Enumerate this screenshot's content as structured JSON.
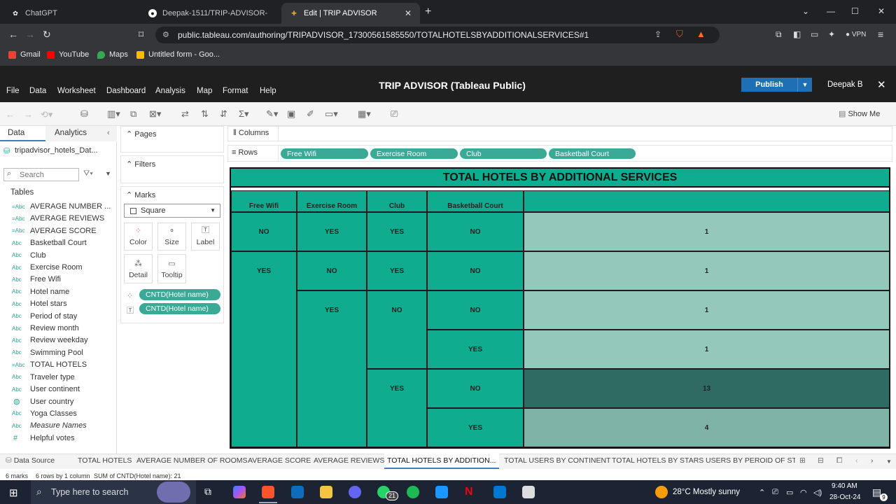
{
  "browser": {
    "tabs": [
      {
        "title": "ChatGPT"
      },
      {
        "title": "Deepak-1511/TRIP-ADVISOR-"
      },
      {
        "title": "Edit | TRIP ADVISOR"
      }
    ],
    "url": "public.tableau.com/authoring/TRIPADVISOR_17300561585550/TOTALHOTELSBYADDITIONALSERVICES#1",
    "vpn_label": "VPN",
    "bookmarks": [
      "Gmail",
      "YouTube",
      "Maps",
      "Untitled form - Goo..."
    ]
  },
  "tableau": {
    "menu": [
      "File",
      "Data",
      "Worksheet",
      "Dashboard",
      "Analysis",
      "Map",
      "Format",
      "Help"
    ],
    "workbook_title": "TRIP ADVISOR (Tableau Public)",
    "publish_label": "Publish",
    "user": "Deepak B",
    "show_me": "Show Me"
  },
  "data_pane": {
    "tab_data": "Data",
    "tab_analytics": "Analytics",
    "datasource": "tripadvisor_hotels_Dat...",
    "search_placeholder": "Search",
    "tables_label": "Tables",
    "fields": [
      {
        "type": "=Abc",
        "name": "AVERAGE NUMBER ..."
      },
      {
        "type": "=Abc",
        "name": "AVERAGE REVIEWS"
      },
      {
        "type": "=Abc",
        "name": "AVERAGE SCORE"
      },
      {
        "type": "Abc",
        "name": "Basketball Court"
      },
      {
        "type": "Abc",
        "name": "Club"
      },
      {
        "type": "Abc",
        "name": "Exercise Room"
      },
      {
        "type": "Abc",
        "name": "Free Wifi"
      },
      {
        "type": "Abc",
        "name": "Hotel name"
      },
      {
        "type": "Abc",
        "name": "Hotel stars"
      },
      {
        "type": "Abc",
        "name": "Period of stay"
      },
      {
        "type": "Abc",
        "name": "Review month"
      },
      {
        "type": "Abc",
        "name": "Review weekday"
      },
      {
        "type": "Abc",
        "name": "Swimming Pool"
      },
      {
        "type": "=Abc",
        "name": "TOTAL HOTELS"
      },
      {
        "type": "Abc",
        "name": "Traveler type"
      },
      {
        "type": "Abc",
        "name": "User continent"
      },
      {
        "type": "globe",
        "name": "User country"
      },
      {
        "type": "Abc",
        "name": "Yoga Classes"
      },
      {
        "type": "Abc",
        "name": "Measure Names"
      },
      {
        "type": "#",
        "name": "Helpful votes"
      }
    ]
  },
  "shelves": {
    "pages": "Pages",
    "filters": "Filters",
    "marks": "Marks",
    "mark_type": "Square",
    "columns": "Columns",
    "rows": "Rows",
    "row_pills": [
      "Free Wifi",
      "Exercise Room",
      "Club",
      "Basketball Court"
    ],
    "mark_buttons": [
      "Color",
      "Size",
      "Label",
      "Detail",
      "Tooltip"
    ],
    "mark_pills": [
      "CNTD(Hotel name)",
      "CNTD(Hotel name)"
    ]
  },
  "viz": {
    "title": "TOTAL HOTELS BY ADDITIONAL SERVICES",
    "headers": [
      "Free Wifi",
      "Exercise Room",
      "Club",
      "Basketball Court"
    ],
    "rows": [
      {
        "free_wifi": "NO",
        "exercise_room": "YES",
        "club": "YES",
        "basketball_court": "NO",
        "count": "1",
        "color": "#94c8bb"
      },
      {
        "free_wifi": "YES",
        "exercise_room": "NO",
        "club": "YES",
        "basketball_court": "NO",
        "count": "1",
        "color": "#94c8bb"
      },
      {
        "free_wifi": "YES",
        "exercise_room": "YES",
        "club": "NO",
        "basketball_court": "NO",
        "count": "1",
        "color": "#94c8bb"
      },
      {
        "free_wifi": "YES",
        "exercise_room": "YES",
        "club": "NO",
        "basketball_court": "YES",
        "count": "1",
        "color": "#94c8bb"
      },
      {
        "free_wifi": "YES",
        "exercise_room": "YES",
        "club": "YES",
        "basketball_court": "NO",
        "count": "13",
        "color": "#2f6b63"
      },
      {
        "free_wifi": "YES",
        "exercise_room": "YES",
        "club": "YES",
        "basketball_court": "YES",
        "count": "4",
        "color": "#7fb3a8"
      }
    ]
  },
  "sheet_tabs": [
    "Data Source",
    "TOTAL HOTELS",
    "AVERAGE NUMBER OF ROOMS",
    "AVERAGE SCORE",
    "AVERAGE REVIEWS",
    "TOTAL HOTELS BY ADDITION...",
    "TOTAL USERS BY CONTINENT",
    "TOTAL HOTELS BY STARS",
    "USERS BY PEROID OF STAY"
  ],
  "status": {
    "marks": "6 marks",
    "rows": "6 rows by 1 column",
    "sum": "SUM of CNTD(Hotel name): 21"
  },
  "taskbar": {
    "search_placeholder": "Type here to search",
    "whatsapp_badge": "21",
    "weather": "28°C  Mostly sunny",
    "time": "9:40 AM",
    "date": "28-Oct-24",
    "notif_count": "9"
  }
}
